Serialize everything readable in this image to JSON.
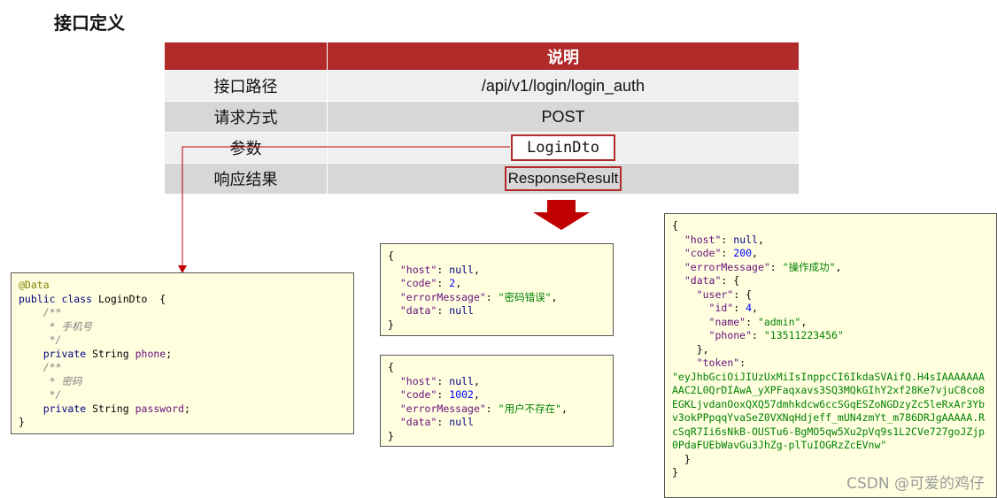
{
  "title": "接口定义",
  "table": {
    "header_left": "",
    "header_right": "说明",
    "rows": [
      {
        "label": "接口路径",
        "value": "/api/v1/login/login_auth"
      },
      {
        "label": "请求方式",
        "value": "POST"
      },
      {
        "label": "参数",
        "value": "LoginDto"
      },
      {
        "label": "响应结果",
        "value": "ResponseResult"
      }
    ]
  },
  "code_login_dto": {
    "annotation": "@Data",
    "class_decl_kw": "public class",
    "class_name": "LoginDto",
    "comment1_open": "/**",
    "comment1_text": " * 手机号",
    "comment_close": " */",
    "field1_kw": "private",
    "field1_type": "String",
    "field1_name": "phone",
    "comment2_open": "/**",
    "comment2_text": " * 密码",
    "field2_kw": "private",
    "field2_type": "String",
    "field2_name": "password"
  },
  "response_error1": {
    "host": "null",
    "code": "2",
    "errorMessage": "\"密码错误\"",
    "data": "null"
  },
  "response_error2": {
    "host": "null",
    "code": "1002",
    "errorMessage": "\"用户不存在\"",
    "data": "null"
  },
  "response_success": {
    "host": "null",
    "code": "200",
    "errorMessage": "\"操作成功\"",
    "user_id": "4",
    "user_name": "\"admin\"",
    "user_phone": "\"13511223456\"",
    "token": "\"eyJhbGciOiJIUzUxMiIsInppcCI6IkdaSVAifQ.H4sIAAAAAAAAAC2L0QrDIAwA_yXPFaqxavs3SQ3MQkGIhY2xf28Ke7vjuC8co8EGKLjvdanOoxQXQ57dmhkdcw6ccSGqESZoNGDzyZc5leRxAr3Ybv3okPPpqqYvaSeZ0VXNqHdjeff_mUN4zmYt_m786DRJgAAAAA.RcSqR7Ii6sNkB-OUSTu6-BgMO5qw5Xu2pVq9s1L2CVe727goJZjp0PdaFUEbWavGu3JhZg-plTuIOGRzZcEVnw\""
  },
  "watermark": "CSDN @可爱的鸡仔",
  "colors": {
    "header_red": "#b02a2a",
    "row_light": "#efefef",
    "row_dark": "#d7d7d7",
    "code_bg": "#ffffe0",
    "arrow_red": "#c00000"
  }
}
